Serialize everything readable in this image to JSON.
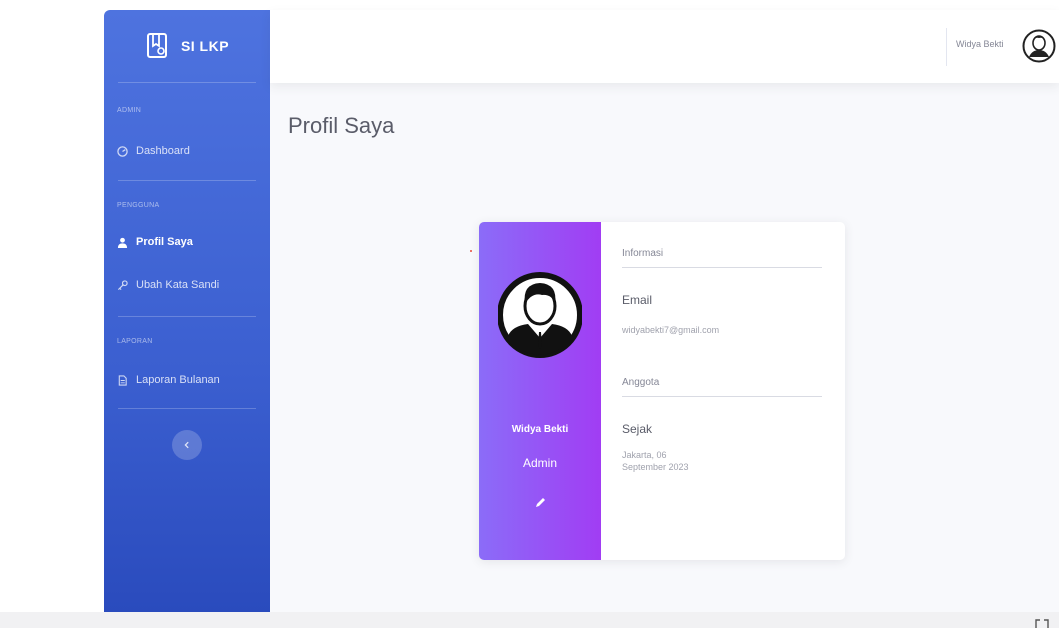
{
  "brand": {
    "name": "SI LKP",
    "icon": "certificate-icon"
  },
  "sidebar": {
    "headings": [
      "ADMIN",
      "PENGGUNA",
      "LAPORAN"
    ],
    "items": [
      {
        "label": "Dashboard",
        "icon": "gauge-icon",
        "active": false
      },
      {
        "label": "Profil Saya",
        "icon": "user-icon",
        "active": true
      },
      {
        "label": "Ubah Kata Sandi",
        "icon": "key-icon",
        "active": false
      },
      {
        "label": "Laporan Bulanan",
        "icon": "file-icon",
        "active": false
      }
    ],
    "toggle_icon": "chevron-left-icon"
  },
  "topbar": {
    "user_name": "Widya Bekti",
    "avatar_icon": "user-avatar-icon"
  },
  "page": {
    "title": "Profil Saya"
  },
  "profile": {
    "name": "Widya Bekti",
    "role": "Admin",
    "edit_icon": "pencil-icon",
    "section_info": "Informasi",
    "email_label": "Email",
    "email_value": "widyabekti7@gmail.com",
    "section_member": "Anggota",
    "since_label": "Sejak",
    "since_value_line1": "Jakarta, 06",
    "since_value_line2": "September 2023"
  },
  "colors": {
    "sidebar": "#4e73df",
    "card_gradient_start": "#8b6cf8",
    "card_gradient_end": "#a13df3"
  }
}
